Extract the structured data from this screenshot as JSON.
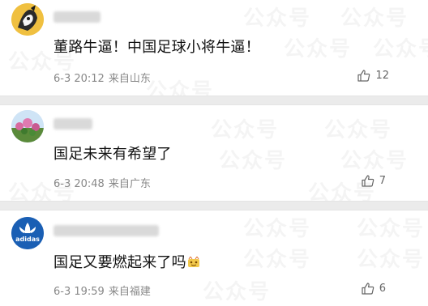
{
  "comments": [
    {
      "content": "董路牛逼！中国足球小将牛逼！",
      "time": "6-3 20:12",
      "location": "来自山东",
      "likes": "12",
      "avatar_icon": "cartoon-character-avatar-icon"
    },
    {
      "content": "国足未来有希望了",
      "time": "6-3 20:48",
      "location": "来自广东",
      "likes": "7",
      "avatar_icon": "flowers-avatar-icon"
    },
    {
      "content": "国足又要燃起来了吗",
      "time": "6-3 19:59",
      "location": "来自福建",
      "likes": "6",
      "avatar_icon": "adidas-logo-avatar-icon",
      "avatar_text": "adidas"
    }
  ],
  "watermark_text": "公众号",
  "colors": {
    "text": "#111111",
    "meta": "#888888",
    "divider": "#ebebeb",
    "adidas_blue": "#1a5fb4"
  }
}
